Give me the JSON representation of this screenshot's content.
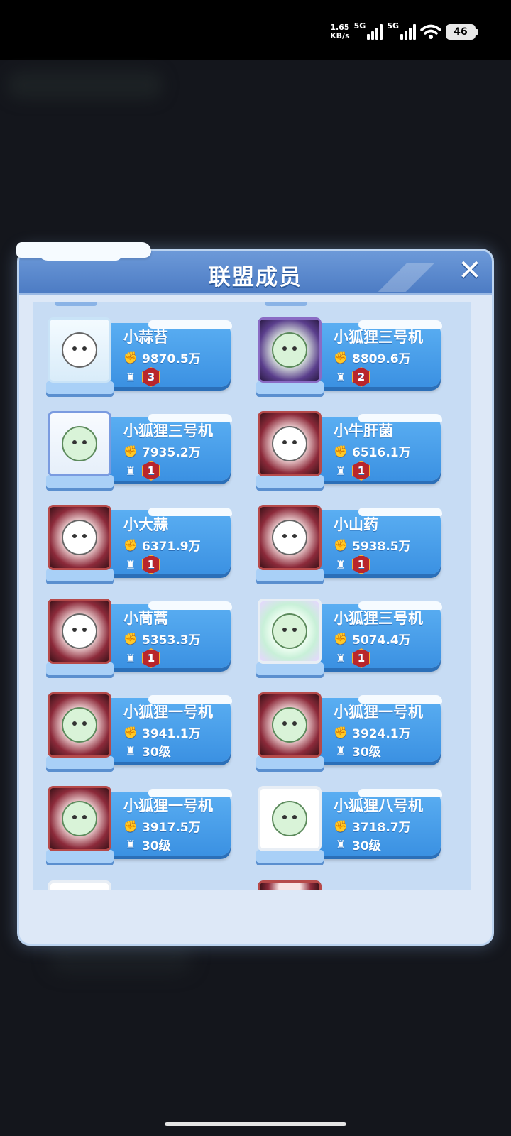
{
  "status_bar": {
    "speed_value": "1.65",
    "speed_unit": "KB/s",
    "net1": "5G",
    "net2": "5G",
    "battery": "46"
  },
  "panel": {
    "title": "联盟成员"
  },
  "members": [
    {
      "name": "小蒜苔",
      "power": "9870.5万",
      "level": "3",
      "level_type": "badge"
    },
    {
      "name": "小狐狸三号机",
      "power": "8809.6万",
      "level": "2",
      "level_type": "badge"
    },
    {
      "name": "小狐狸三号机",
      "power": "7935.2万",
      "level": "1",
      "level_type": "badge"
    },
    {
      "name": "小牛肝菌",
      "power": "6516.1万",
      "level": "1",
      "level_type": "badge"
    },
    {
      "name": "小大蒜",
      "power": "6371.9万",
      "level": "1",
      "level_type": "badge"
    },
    {
      "name": "小山药",
      "power": "5938.5万",
      "level": "1",
      "level_type": "badge"
    },
    {
      "name": "小茼蒿",
      "power": "5353.3万",
      "level": "1",
      "level_type": "badge"
    },
    {
      "name": "小狐狸三号机",
      "power": "5074.4万",
      "level": "1",
      "level_type": "badge"
    },
    {
      "name": "小狐狸一号机",
      "power": "3941.1万",
      "level": "30级",
      "level_type": "text"
    },
    {
      "name": "小狐狸一号机",
      "power": "3924.1万",
      "level": "30级",
      "level_type": "text"
    },
    {
      "name": "小狐狸一号机",
      "power": "3917.5万",
      "level": "30级",
      "level_type": "text"
    },
    {
      "name": "小狐狸八号机",
      "power": "3718.7万",
      "level": "30级",
      "level_type": "text"
    }
  ],
  "icons": {
    "power": "fist-icon",
    "level": "castle-icon",
    "close": "close-icon"
  }
}
